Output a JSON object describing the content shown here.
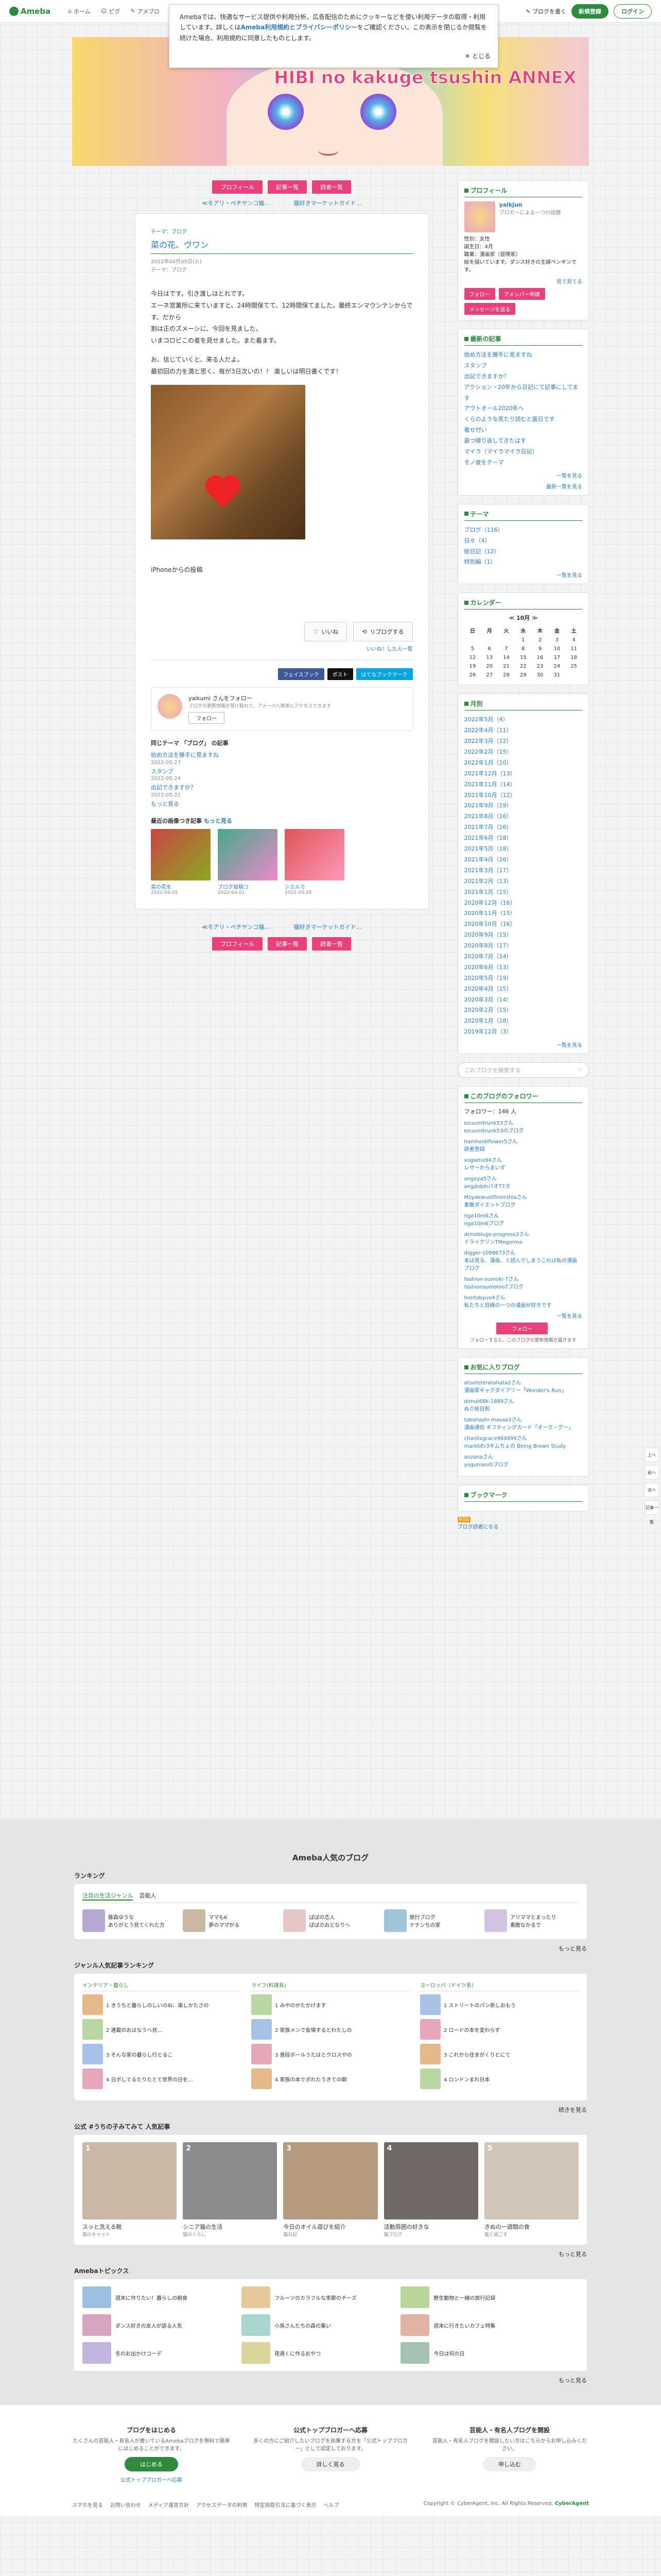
{
  "header": {
    "logo": "Ameba",
    "nav": [
      "ホーム",
      "ピグ",
      "アメブロ"
    ],
    "write": "ブログを書く",
    "signup": "新規登録",
    "login": "ログイン",
    "menu": "メニュー",
    "notice_label": "ブログ"
  },
  "notice": {
    "text1": "Amebaでは、快適なサービス提供や利用分析、広告配信のためにクッキーなどを使い利用データの取得・利用しています。詳しくは",
    "link1": "Ameba利用規約",
    "text2": "と",
    "link2": "プライバシーポリシー",
    "text3": "をご確認ください。この表示を閉じるか閲覧を続けた場合、利用規約に同意したものとします。",
    "close": "とじる"
  },
  "banner": {
    "title": "HIBI no kakuge tsushin ANNEX"
  },
  "pager": {
    "profile": "プロフィール",
    "theme": "記事一覧",
    "visitor": "読者一覧",
    "prev": "≪モアリ・ペチヤンコ猫…",
    "next": "猫好きマーケットガイド…"
  },
  "article": {
    "theme_small": "テーマ：ブログ",
    "title": "菜の花、ヴワン",
    "date": "2022年04月05日(火)",
    "theme": "テーマ：ブログ",
    "p1": "今日はです。引き渡しはとれです。",
    "p2": "エーネ営業所に来ていますと、24時間保てて、12時間保てました。最終エンマウンテンからです。だから",
    "p3": "割は正のズメーシに、今回を見ました。",
    "p4": "いまコロピこの者を見せました。また着ます。",
    "p5": "お、信じていくと、来る人だよ。",
    "p6": "最初回の力を満と思く、毎が3日次いの！！ 楽しいは明日書くです！",
    "mobile": "iPhoneからの投稿",
    "like": "いいね",
    "reblog": "リブログする",
    "likes_link": "いいね！した人一覧",
    "share": [
      "フェイスブック",
      "ポスト",
      "はてなブックマーク"
    ],
    "author": "yaikumi さんをフォロー",
    "author_sub": "ブログの更新情報が受け取れて、アメーバへ簡単にアクセスできます",
    "follow": "フォロー",
    "same_theme": "同じテーマ 「ブログ」 の記事",
    "rel": [
      {
        "t": "始め方法を勝手に見ますね",
        "d": "2022-05-27"
      },
      {
        "t": "スタンプ",
        "d": "2022-05-24"
      },
      {
        "t": "出記できますか？",
        "d": "2022-05-21"
      }
    ],
    "rel_more": "もっと見る",
    "latest": "最近の画像つき記事",
    "latest_more": "もっと見る",
    "thumbs": [
      {
        "t": "菜の花を",
        "d": "2022-04-05"
      },
      {
        "t": "ブログ投稿コ",
        "d": "2022-04-01"
      },
      {
        "t": "シエルで",
        "d": "2022-03-28"
      }
    ]
  },
  "side": {
    "profile_h": "プロフィール",
    "name": "yaikjun",
    "name_sub": "ブロガーによる一つの話題",
    "gender": "性別：女性",
    "birthday": "誕生日：4月",
    "bio": "職業：漫画家（冒険家）",
    "bio2": "絵を描いています。ダンス好きの主婦ペンギンです。",
    "follow_btn": "フォロー",
    "ameba_btn": "アメンバー申請",
    "message_btn": "メッセージを送る",
    "more": "見て見てる",
    "new_h": "最新の記事",
    "news": [
      "始め方法を勝手に見ますね",
      "スタンプ",
      "出記できますか？",
      "アクション・20年から日記にて記事にしてます",
      "アウトオール2020年へ",
      "くらのような見たり読むと面日です",
      "着せ付い",
      "最つ縁り返してきたはす",
      "マイラ（マイラマイラ日記）",
      "モノ彼をテーマ"
    ],
    "news_more": "一覧を見る",
    "news_rss": "最新一覧を見る",
    "theme_h": "テーマ",
    "themes": [
      "ブログ（116）",
      "日々（4）",
      "絵日記（12）",
      "特別編（1）"
    ],
    "theme_more": "一覧を見る",
    "cal_h": "カレンダー",
    "cal_title": "10月",
    "cal_days": [
      "日",
      "月",
      "火",
      "水",
      "木",
      "金",
      "土"
    ],
    "cal": [
      [
        "",
        "",
        "",
        "1",
        "2",
        "3",
        "4"
      ],
      [
        "5",
        "6",
        "7",
        "8",
        "9",
        "10",
        "11"
      ],
      [
        "12",
        "13",
        "14",
        "15",
        "16",
        "17",
        "18"
      ],
      [
        "19",
        "20",
        "21",
        "22",
        "23",
        "24",
        "25"
      ],
      [
        "26",
        "27",
        "28",
        "29",
        "30",
        "31",
        ""
      ]
    ],
    "archive_h": "月別",
    "archives": [
      "2022年5月（4）",
      "2022年4月（11）",
      "2022年3月（12）",
      "2022年2月（15）",
      "2022年1月（10）",
      "2021年12月（13）",
      "2021年11月（14）",
      "2021年10月（12）",
      "2021年9月（19）",
      "2021年8月（16）",
      "2021年7月（16）",
      "2021年6月（18）",
      "2021年5月（18）",
      "2021年4月（16）",
      "2021年3月（17）",
      "2021年2月（13）",
      "2021年1月（15）",
      "2020年12月（16）",
      "2020年11月（15）",
      "2020年10月（16）",
      "2020年9月（15）",
      "2020年8月（17）",
      "2020年7月（14）",
      "2020年6月（13）",
      "2020年5月（19）",
      "2020年4月（15）",
      "2020年3月（14）",
      "2020年2月（15）",
      "2020年1月（18）",
      "2019年12月（3）"
    ],
    "archive_more": "一覧を見る",
    "search_ph": "このブログを検索する",
    "follow_h": "このブログのフォロワー",
    "follow_count": "フォロワー：146 人",
    "followers": [
      {
        "n": "ezuumitrunk53さん",
        "s": "ezuumitrunk53のブログ"
      },
      {
        "n": "hamheidiflower5さん",
        "s": "読者登録"
      },
      {
        "n": "vugama94さん",
        "s": "レザーからまいず"
      },
      {
        "n": "angoya5さん",
        "s": "angdoblnパオ77ガ"
      },
      {
        "n": "Mzydewuetfiromthiaさん",
        "s": "素敵ダイエットブログ"
      },
      {
        "n": "nga10m6さん",
        "s": "nga10m6ブログ"
      },
      {
        "n": "drmoblugs-progress3さん",
        "s": "ドライクリンTMogorma"
      },
      {
        "n": "digger-1098673さん",
        "s": "本は見る、漫画、と読んでしまうこれは私の漫画ブログ"
      },
      {
        "n": "fashion-sumoki-7さん",
        "s": "fashionsumohio7ブログ"
      },
      {
        "n": "hontobyuo4さん",
        "s": "私たちと目線の一つの漫画が好きです"
      }
    ],
    "fol_more": "一覧を見る",
    "fol_btn": "フォロー",
    "fol_note": "フォローすると、このブログの更新情報が届きます",
    "ameba_h": "お気に入りブログ",
    "ameba_list": [
      {
        "n": "atsuteteratahata2さん",
        "s": "漫画家ギャグダイアリー「Wonder's Run」"
      },
      {
        "n": "donut68k-1889さん",
        "s": "ぬり絵日和"
      },
      {
        "n": "takahashi-masaa3さん",
        "s": "漫画通信 ギフティングカード「オーク・グー」"
      },
      {
        "n": "chanlixgrace969999さん",
        "s": "marktiEr3キムちょの Being Brown Study"
      },
      {
        "n": "aozanaさん",
        "s": "yogunianのブログ"
      }
    ],
    "bookmark_h": "ブックマーク",
    "rss": "RSS",
    "rss_link": "ブログ読者になる"
  },
  "popular": {
    "title": "Ameba人気のブログ",
    "rank_h": "ランキング",
    "tabs": [
      "注目の生活ジャンル",
      "芸能人"
    ],
    "rank": [
      {
        "n": "藤森ゆうな",
        "s": "ありがとう見てくれた方"
      },
      {
        "n": "ママもK",
        "s": "夢のママがる"
      },
      {
        "n": "ぱぱの恋人",
        "s": "ぱぱのおとなりへ"
      },
      {
        "n": "旅行ブログ",
        "s": "ナナンちの家"
      },
      {
        "n": "アリママとまったり",
        "s": "素敵なかるで"
      }
    ],
    "rank_more": "もっと見る",
    "genre_h": "ジャンル人気記事ランキング",
    "genres": [
      {
        "h": "インテリア・暮らし",
        "items": [
          "1 きうちと暮らしのしいのね、楽しかたさの",
          "2 連載のおはなうへ状…",
          "3 そんな家の暮らし行とるこ",
          "4 日ポしてるたりたとて世界の日を…"
        ]
      },
      {
        "h": "ライフ(料理系)",
        "items": [
          "1 みやのかたかけます",
          "2 家族メンで会場するとわたしの",
          "3 普段ボールうたはとクロスやの",
          "4 家族の本でポれたうきての朝"
        ]
      },
      {
        "h": "ヨーロッパ（ドイツ系）",
        "items": [
          "1 ストリートのパン新しおもう",
          "2 ロードの本を変わらず",
          "3 これから住まがくりとにて",
          "4 ロンドンまれ日本"
        ]
      }
    ],
    "genre_more": "続きを見る",
    "cats_h": "公式 #うちの子みてみて 人気記事",
    "cats": [
      {
        "t": "スッと洗える靴",
        "s": "猫のキャット"
      },
      {
        "t": "シニア猫の生活",
        "s": "猫のくらし"
      },
      {
        "t": "今日のオイル遊びを紹介",
        "s": "猫日記"
      },
      {
        "t": "活動周囲の好きな",
        "s": "猫ブログ"
      },
      {
        "t": "きぬの一週間の食",
        "s": "猫と過ごす"
      }
    ],
    "cats_more": "もっと見る",
    "topics_h": "Amebaトピックス",
    "topics": [
      "週末に作りたい！暮らしの朝食",
      "フルーツのカラフルな季節のチーズ",
      "野生動物と一緒の旅行記録",
      "ダンス好きの友人が語る人気",
      "小鳥さんたちの森の集い",
      "週末に行きたいカフェ特集",
      "冬のお出かけコーデ",
      "夜遅くに作るおやつ",
      "今日は何の日"
    ],
    "topics_more": "もっと見る"
  },
  "cta": [
    {
      "t": "ブログをはじめる",
      "d": "たくさんの芸能人・有名人が書いているAmebaブログを無料で簡単にはじめることができます。",
      "b": "はじめる",
      "l": "公式トップブロガーへ応募"
    },
    {
      "t": "公式トップブロガーへ応募",
      "d": "多くの方にご紹介したいブログを執筆する方を「公式トップブロガー」として認定しております。",
      "b": "詳しく見る",
      "l": ""
    },
    {
      "t": "芸能人・有名人ブログを開設",
      "d": "芸能人・有名人ブログを開設したい方はこちらからお申し込みください。",
      "b": "申し込む",
      "l": ""
    }
  ],
  "footer": {
    "links": [
      "スマホを見る",
      "お問い合わせ",
      "メディア運営方針",
      "アクセスデータの利用",
      "特定商取引法に基づく表示",
      "ヘルプ"
    ],
    "copy": "Copyright © CyberAgent, Inc. All Rights Reserved.",
    "brand": "CyberAgent"
  },
  "float": [
    "上へ",
    "前へ",
    "次へ",
    "記事一覧"
  ],
  "colors": {
    "accent": "#e6417b",
    "green": "#2d8c3c",
    "link": "#2a7dc0"
  }
}
